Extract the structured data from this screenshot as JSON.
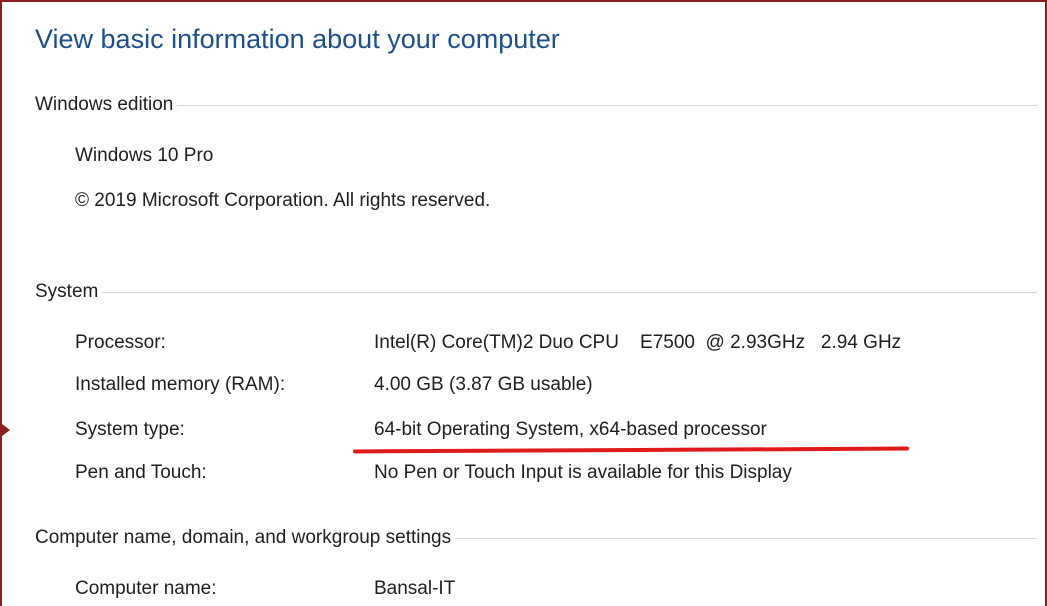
{
  "page_title": "View basic information about your computer",
  "windows_edition": {
    "section_title": "Windows edition",
    "edition": "Windows 10 Pro",
    "copyright": "© 2019 Microsoft Corporation. All rights reserved."
  },
  "system": {
    "section_title": "System",
    "rows": [
      {
        "label": "Processor:",
        "value": "Intel(R) Core(TM)2 Duo CPU    E7500  @ 2.93GHz   2.94 GHz"
      },
      {
        "label": "Installed memory (RAM):",
        "value": "4.00 GB (3.87 GB usable)"
      },
      {
        "label": "System type:",
        "value": "64-bit Operating System, x64-based processor"
      },
      {
        "label": "Pen and Touch:",
        "value": "No Pen or Touch Input is available for this Display"
      }
    ]
  },
  "computer_name": {
    "section_title": "Computer name, domain, and workgroup settings",
    "rows": [
      {
        "label": "Computer name:",
        "value": "Bansal-IT"
      }
    ]
  },
  "colors": {
    "title_blue": "#1e4e8c",
    "frame_border": "#8b1d1d",
    "annotation_underline": "#e01a1a"
  }
}
